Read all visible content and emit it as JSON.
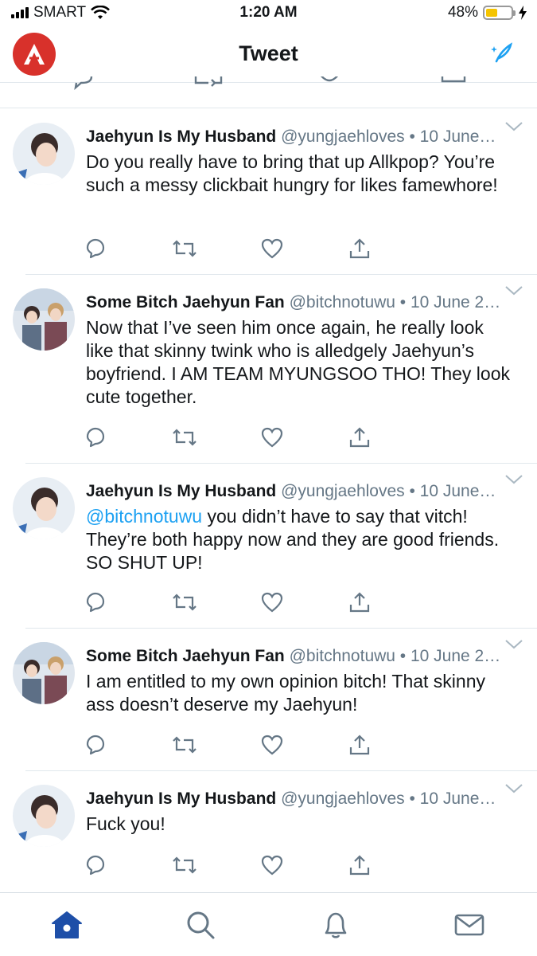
{
  "status_bar": {
    "carrier": "SMART",
    "time": "1:20 AM",
    "battery_percent": "48%",
    "battery_level": 0.48
  },
  "header": {
    "title": "Tweet",
    "app_icon": "app-logo",
    "compose_icon": "compose-sparkle-icon"
  },
  "tweets": [
    {
      "name": "Jaehyun Is My Husband",
      "meta": "@yungjaehloves • 10 June…",
      "text": "Do you really have to bring that up Allkpop? You’re such a messy clickbait hungry for likes famewhore!"
    },
    {
      "name": "Some Bitch Jaehyun Fan",
      "meta": "@bitchnotuwu • 10 June 2…",
      "text": "Now that I’ve seen him once again, he really look like that skinny twink who is alledgely Jaehyun’s boyfriend. I AM TEAM MYUNGSOO THO! They look cute together."
    },
    {
      "name": "Jaehyun Is My Husband",
      "meta": "@yungjaehloves • 10 June…",
      "mention": "@bitchnotuwu",
      "text": " you didn’t have to say that vitch! They’re both happy now and they are good friends. SO SHUT UP!"
    },
    {
      "name": "Some Bitch Jaehyun Fan",
      "meta": "@bitchnotuwu • 10 June 2…",
      "text": "I am entitled to my own opinion bitch! That skinny ass doesn’t deserve my Jaehyun!"
    },
    {
      "name": "Jaehyun Is My Husband",
      "meta": "@yungjaehloves • 10 June…",
      "text": "Fuck you!"
    }
  ],
  "tabbar": {
    "tabs": [
      "home-icon",
      "search-icon",
      "notifications-bell-icon",
      "messages-envelope-icon"
    ],
    "active": "home-icon"
  },
  "colors": {
    "accent": "#1da1f2",
    "muted": "#657786",
    "logo_red": "#d8312b",
    "active_tab": "#1e4fa8"
  }
}
